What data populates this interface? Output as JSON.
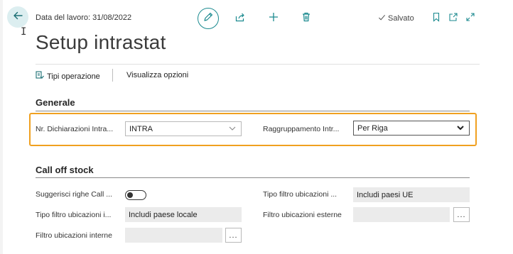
{
  "header": {
    "work_date": "Data del lavoro: 31/08/2022",
    "saved_label": "Salvato",
    "title": "Setup intrastat"
  },
  "icons": {
    "back": "back-arrow-icon",
    "edit": "pencil-icon",
    "share": "share-icon",
    "new": "plus-icon",
    "delete": "trash-icon",
    "saved": "checkmark-icon",
    "bookmark": "bookmark-icon",
    "open_new_window": "open-new-window-icon",
    "expand": "expand-icon",
    "operation_types": "operation-types-icon"
  },
  "actions": {
    "operation_types": "Tipi operazione",
    "view_options": "Visualizza opzioni"
  },
  "sections": {
    "general": {
      "title": "Generale",
      "decl_no_label": "Nr. Dichiarazioni Intra...",
      "decl_no_value": "INTRA",
      "grouping_label": "Raggruppamento Intr...",
      "grouping_value": "Per Riga"
    },
    "call_off": {
      "title": "Call off stock",
      "suggest_label": "Suggerisci righe Call ...",
      "suggest_value": false,
      "loc_filter_type_label": "Tipo filtro ubicazioni ...",
      "loc_filter_type_value": "Includi paesi UE",
      "int_loc_filter_type_label": "Tipo filtro ubicazioni i...",
      "int_loc_filter_type_value": "Includi paese locale",
      "ext_loc_filter_label": "Filtro ubicazioni esterne",
      "ext_loc_filter_value": "",
      "int_loc_filter_label": "Filtro ubicazioni interne",
      "int_loc_filter_value": "",
      "ellipsis": "..."
    }
  },
  "colors": {
    "accent": "#1b8a8f",
    "highlight": "#f0a020"
  }
}
